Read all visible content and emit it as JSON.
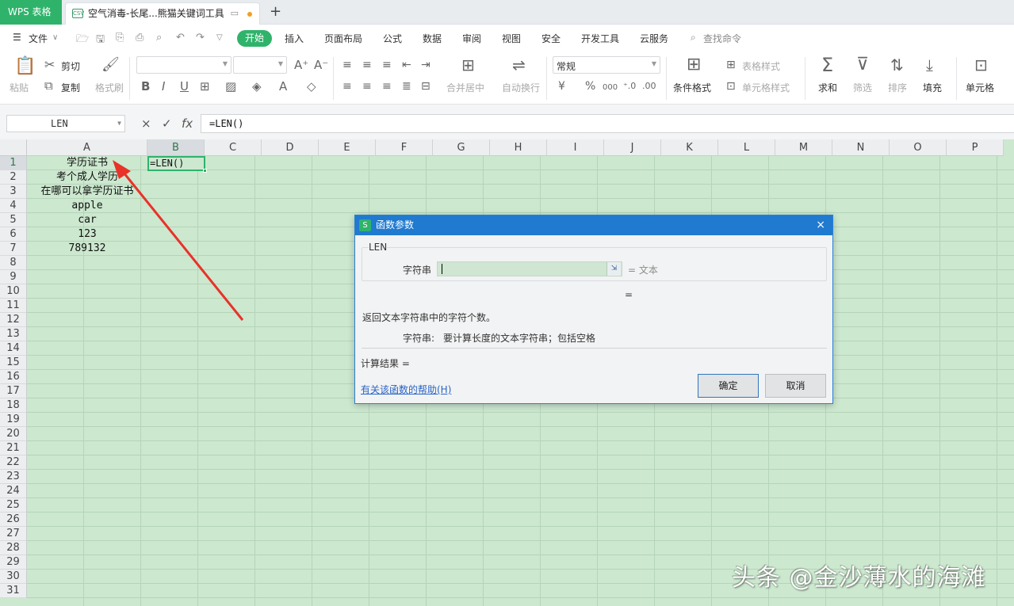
{
  "titlebar": {
    "app_label": "WPS 表格",
    "doc_tab_label": "空气消毒-长尾...熊猫关键词工具",
    "new_tab_symbol": "+"
  },
  "menubar": {
    "file_label": "文件",
    "items": [
      "开始",
      "插入",
      "页面布局",
      "公式",
      "数据",
      "审阅",
      "视图",
      "安全",
      "开发工具",
      "云服务"
    ],
    "search_label": "查找命令"
  },
  "ribbon": {
    "paste": "粘贴",
    "cut": "剪切",
    "copy": "复制",
    "format_painter": "格式刷",
    "merge_center": "合并居中",
    "wrap_text": "自动换行",
    "number_format": "常规",
    "conditional_format": "条件格式",
    "table_style": "表格样式",
    "cell_style": "单元格样式",
    "sum": "求和",
    "filter": "筛选",
    "sort": "排序",
    "fill": "填充",
    "cell": "单元格",
    "currency_symbol": "¥",
    "percent_symbol": "%",
    "thousands_symbol": "000"
  },
  "formulabar": {
    "name_box": "LEN",
    "cancel_symbol": "×",
    "enter_symbol": "✓",
    "fx_label": "fx",
    "formula": "=LEN()"
  },
  "sheet": {
    "columns": [
      "A",
      "B",
      "C",
      "D",
      "E",
      "F",
      "G",
      "H",
      "I",
      "J",
      "K",
      "L",
      "M",
      "N",
      "O",
      "P"
    ],
    "rows": [
      "1",
      "2",
      "3",
      "4",
      "5",
      "6",
      "7",
      "8",
      "9",
      "10",
      "11",
      "12",
      "13",
      "14",
      "15",
      "16",
      "17",
      "18",
      "19",
      "20",
      "21",
      "22",
      "23",
      "24",
      "25",
      "26",
      "27",
      "28",
      "29",
      "30",
      "31"
    ],
    "col_a_values": [
      "学历证书",
      "考个成人学历",
      "在哪可以拿学历证书",
      "apple",
      "car",
      "123",
      "789132"
    ],
    "b1_value": "=LEN()"
  },
  "dialog": {
    "title": "函数参数",
    "close_symbol": "×",
    "function_name": "LEN",
    "arg_label": "字符串",
    "arg_value": "",
    "arg_result": "= 文本",
    "function_result": "=",
    "description": "返回文本字符串中的字符个数。",
    "arg_desc_name": "字符串:",
    "arg_desc_text": "要计算长度的文本字符串；包括空格",
    "calc_result": "计算结果 =",
    "help_link": "有关该函数的帮助(H)",
    "ok_label": "确定",
    "cancel_label": "取消"
  },
  "watermark": "头条 @金沙薄水的海滩",
  "colors": {
    "accent": "#2fb36b",
    "sheet_bg": "#cce8cf",
    "dialog_title": "#1f7ad0",
    "arrow": "#e8322a"
  }
}
